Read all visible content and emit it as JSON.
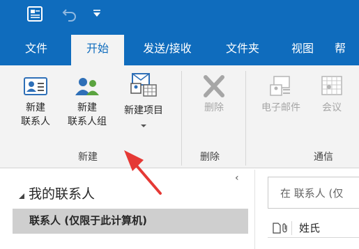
{
  "tabs": [
    {
      "label": "文件",
      "active": false
    },
    {
      "label": "开始",
      "active": true
    },
    {
      "label": "发送/接收",
      "active": false
    },
    {
      "label": "文件夹",
      "active": false
    },
    {
      "label": "视图",
      "active": false
    },
    {
      "label": "帮",
      "active": false
    }
  ],
  "ribbon": {
    "new_group": {
      "label": "新建",
      "new_contact": {
        "line1": "新建",
        "line2": "联系人"
      },
      "new_contact_group": {
        "line1": "新建",
        "line2": "联系人组"
      },
      "new_items": {
        "label": "新建项目"
      }
    },
    "delete_group": {
      "label": "删除",
      "delete": {
        "label": "删除"
      }
    },
    "communicate_group": {
      "label": "通信",
      "email": {
        "label": "电子邮件"
      },
      "meeting": {
        "label": "会议"
      }
    }
  },
  "nav": {
    "collapse_glyph": "‹",
    "header": "我的联系人",
    "selected_item": "联系人 (仅限于此计算机)"
  },
  "search": {
    "placeholder": "在 联系人 (仅"
  },
  "columns": {
    "surname": "姓氏"
  },
  "colors": {
    "accent": "#0f6cbd",
    "ribbon_bg": "#f3f3f3",
    "arrow": "#e53935"
  },
  "icons": [
    "app-icon",
    "undo-icon",
    "qat-dropdown-icon",
    "contact-card-icon",
    "people-group-icon",
    "new-items-icon",
    "delete-x-icon",
    "email-icon",
    "meeting-icon",
    "document-icon",
    "attachment-icon"
  ]
}
